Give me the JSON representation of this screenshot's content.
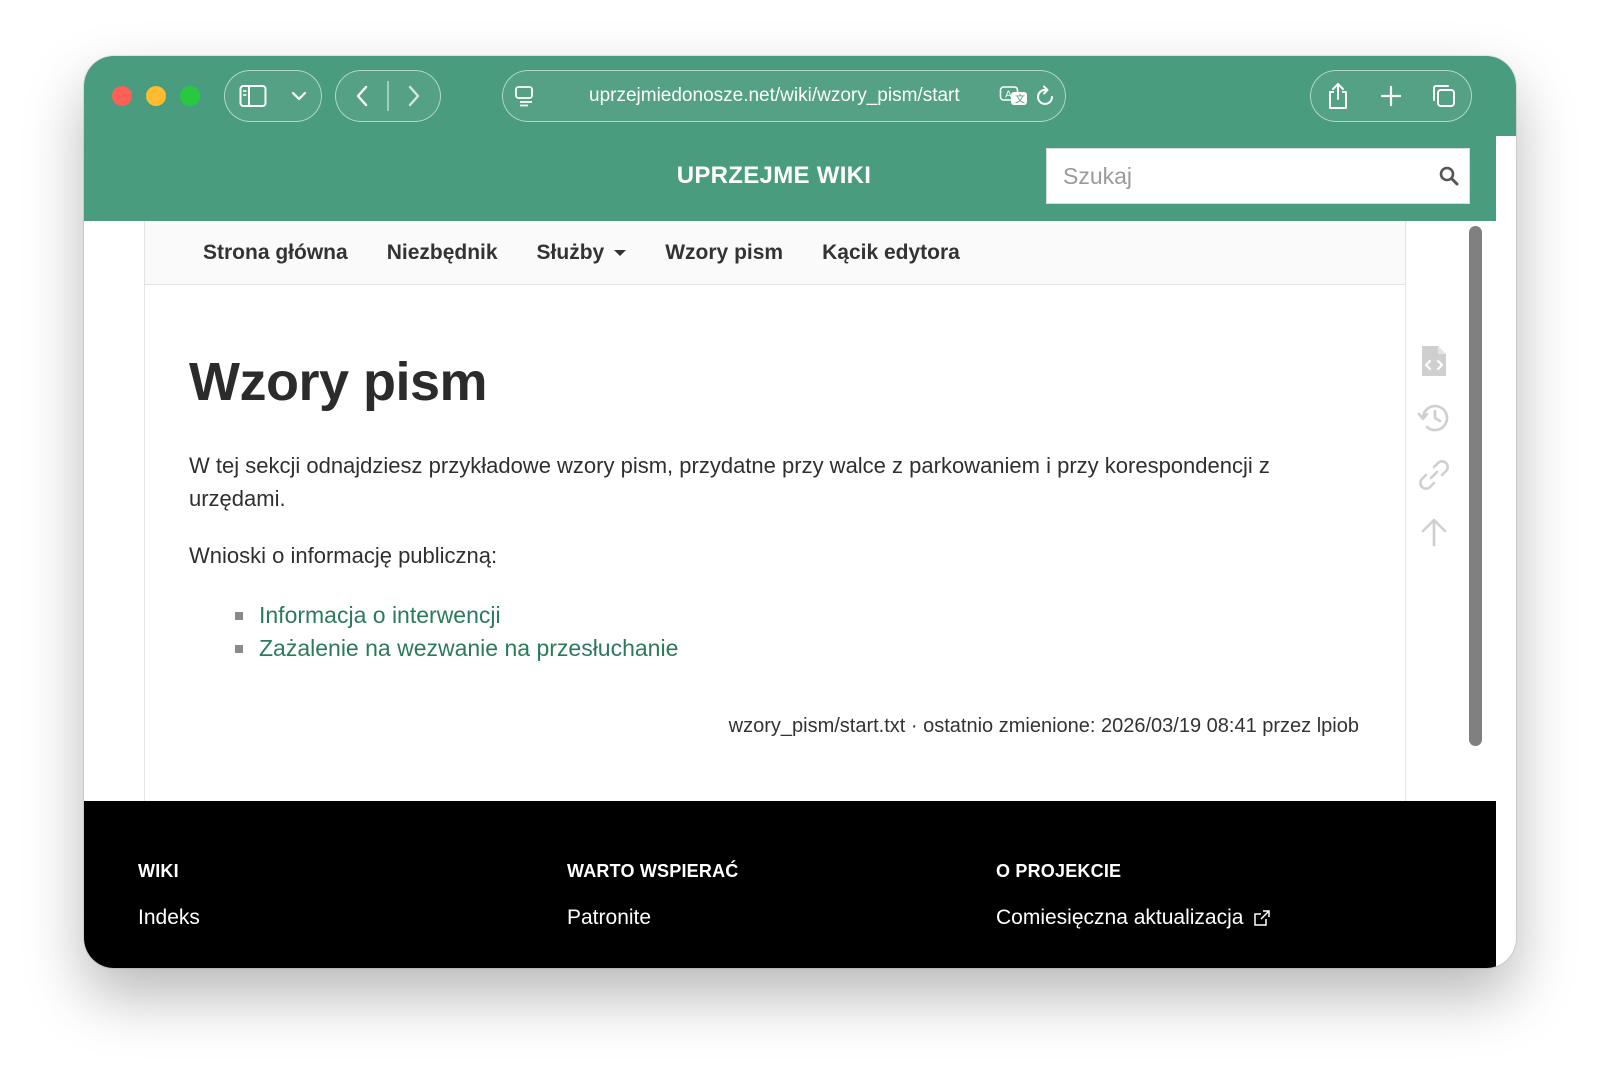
{
  "browser": {
    "url": "uprzejmiedonosze.net/wiki/wzory_pism/start"
  },
  "site": {
    "title": "UPRZEJME WIKI",
    "search_placeholder": "Szukaj"
  },
  "nav": {
    "items": [
      {
        "label": "Strona główna"
      },
      {
        "label": "Niezbędnik"
      },
      {
        "label": "Służby",
        "has_dropdown": true
      },
      {
        "label": "Wzory pism"
      },
      {
        "label": "Kącik edytora"
      }
    ]
  },
  "content": {
    "title": "Wzory pism",
    "intro": "W tej sekcji odnajdziesz przykładowe wzory pism, przydatne przy walce z parkowaniem i przy korespondencji z urzędami.",
    "list_heading": "Wnioski o informację publiczną:",
    "links": [
      {
        "label": "Informacja o interwencji"
      },
      {
        "label": "Zażalenie na wezwanie na przesłuchanie"
      }
    ],
    "meta": "wzory_pism/start.txt · ostatnio zmienione: 2026/03/19 08:41 przez lpiob"
  },
  "tools": [
    "source-icon",
    "history-icon",
    "backlinks-icon",
    "back-to-top-icon"
  ],
  "footer": {
    "columns": [
      {
        "heading": "WIKI",
        "link": "Indeks"
      },
      {
        "heading": "WARTO WSPIERAĆ",
        "link": "Patronite"
      },
      {
        "heading": "O PROJEKCIE",
        "link": "Comiesięczna aktualizacja",
        "external": true
      }
    ]
  },
  "colors": {
    "accent": "#4a9c7e",
    "link": "#2c7a5c",
    "footer_bg": "#000000"
  }
}
